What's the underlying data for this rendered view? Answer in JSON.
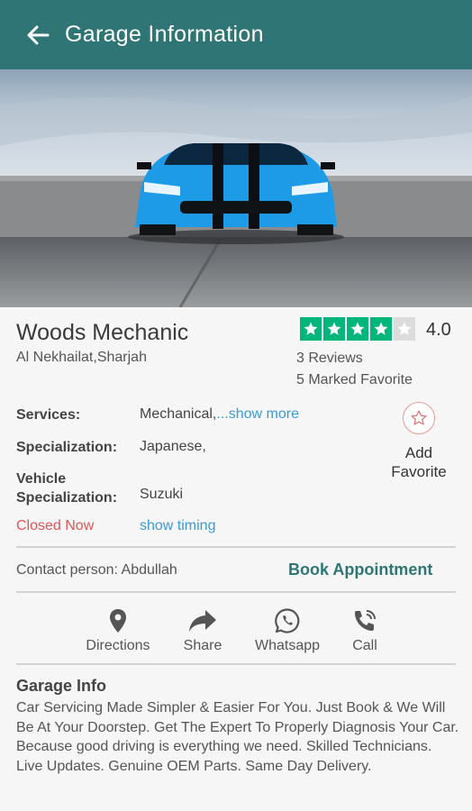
{
  "appbar": {
    "title": "Garage Information",
    "back_icon": "arrow-left-icon",
    "color": "#2f7575"
  },
  "hero": {
    "image": "blue-sports-car"
  },
  "garage": {
    "name": "Woods Mechanic",
    "location": "Al Nekhailat,Sharjah",
    "rating": "4.0",
    "rating_value": 4,
    "rating_max": 5,
    "reviews": "3 Reviews",
    "favorites": "5 Marked Favorite"
  },
  "details": {
    "services_label": "Services:",
    "services_value": "Mechanical,",
    "show_more": "...show more",
    "specialization_label": "Specialization:",
    "specialization_value": "Japanese,",
    "vehicle_label_1": "Vehicle",
    "vehicle_label_2": "Specialization:",
    "vehicle_value": "Suzuki",
    "status": "Closed Now",
    "show_timing": "show timing"
  },
  "favorite": {
    "label_1": "Add",
    "label_2": "Favorite",
    "icon": "star-outline-icon"
  },
  "contact": {
    "text": "Contact person: Abdullah",
    "book": "Book Appointment"
  },
  "actions": [
    {
      "label": "Directions",
      "icon": "location-pin-icon"
    },
    {
      "label": "Share",
      "icon": "share-arrow-icon"
    },
    {
      "label": "Whatsapp",
      "icon": "whatsapp-icon"
    },
    {
      "label": "Call",
      "icon": "phone-call-icon"
    }
  ],
  "info": {
    "title": "Garage Info",
    "body": "Car Servicing Made Simpler & Easier For You. Just Book & We Will Be At Your Doorstep. Get The Expert To Properly Diagnosis Your Car. Because good driving is everything we need. Skilled Technicians. Live Updates. Genuine OEM Parts. Same Day Delivery."
  },
  "colors": {
    "accent": "#2f7575",
    "star": "#00b67a",
    "closed": "#e05555",
    "link": "#3a9bd5"
  }
}
